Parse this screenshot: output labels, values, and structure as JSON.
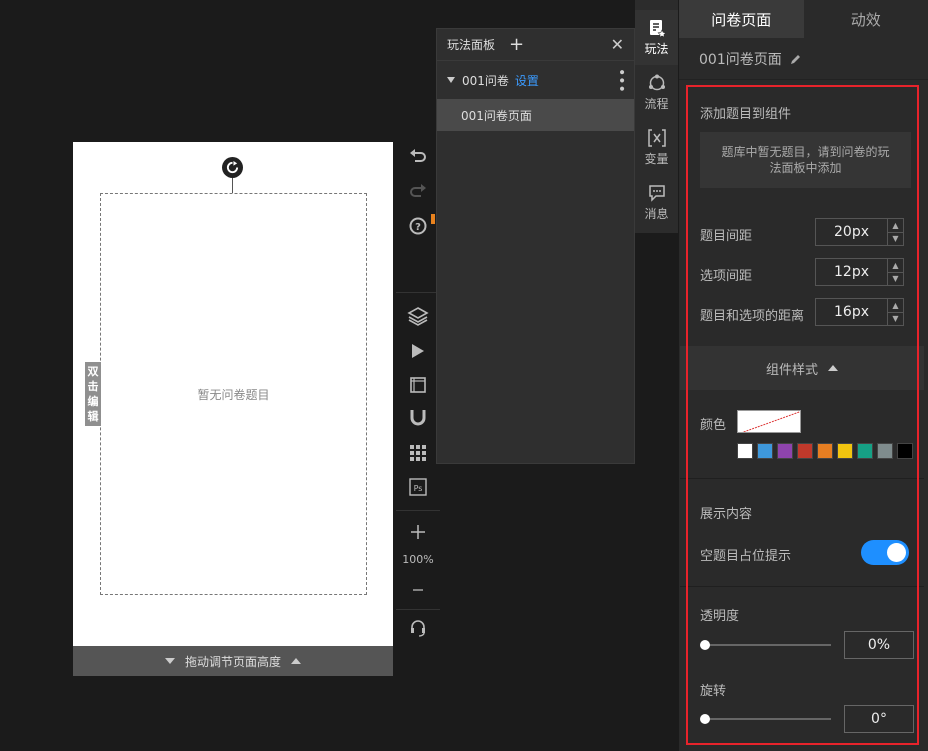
{
  "canvas": {
    "empty_text": "暂无问卷题目",
    "double_click_label": "双击编辑",
    "resize_label": "拖动调节页面高度"
  },
  "tools": {
    "zoom": "100%"
  },
  "play_panel": {
    "title": "玩法面板",
    "tree_item": "001问卷",
    "tree_settings": "设置",
    "child_item": "001问卷页面"
  },
  "side_tabs": [
    {
      "label": "玩法",
      "icon": "play-doc-icon"
    },
    {
      "label": "流程",
      "icon": "flow-icon"
    },
    {
      "label": "变量",
      "icon": "variable-icon"
    },
    {
      "label": "消息",
      "icon": "message-icon"
    }
  ],
  "right_panel": {
    "tabs": [
      "问卷页面",
      "动效"
    ],
    "page_name": "001问卷页面",
    "add_questions_title": "添加题目到组件",
    "empty_hint": "题库中暂无题目，请到问卷的玩法面板中添加",
    "question_spacing_label": "题目间距",
    "question_spacing_value": "20px",
    "option_spacing_label": "选项间距",
    "option_spacing_value": "12px",
    "question_option_gap_label": "题目和选项的距离",
    "question_option_gap_value": "16px",
    "component_style_label": "组件样式",
    "color_label": "颜色",
    "palette": [
      "#ffffff",
      "#3e98db",
      "#8e44ad",
      "#c0392b",
      "#e67e22",
      "#f1c40f",
      "#16a085",
      "#7f8c8d",
      "#000000"
    ],
    "display_content_label": "展示内容",
    "placeholder_toggle_label": "空题目占位提示",
    "placeholder_toggle_on": true,
    "opacity_label": "透明度",
    "opacity_value": "0%",
    "rotation_label": "旋转",
    "rotation_value": "0°"
  }
}
